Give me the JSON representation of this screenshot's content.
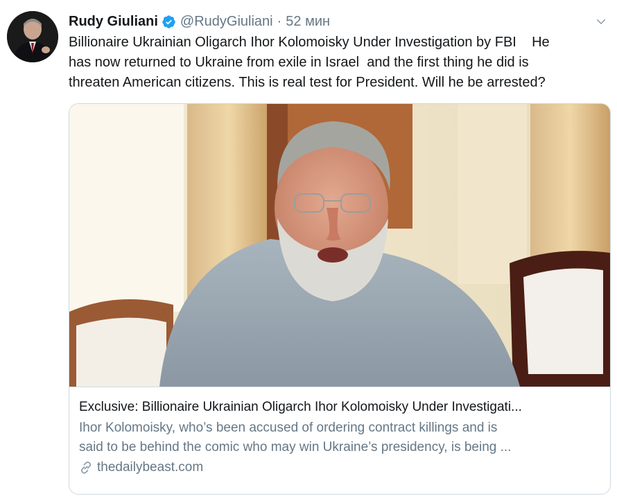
{
  "author": {
    "name": "Rudy Giuliani",
    "handle": "@RudyGiuliani",
    "separator": "·",
    "time": "52 мин",
    "verified": true
  },
  "tweet": {
    "lines": [
      "Billionaire Ukrainian Oligarch Ihor Kolomoisky Under Investigation by FBI    He",
      "has now returned to Ukraine from exile in Israel  and the first thing he did is",
      "threaten American citizens. This is real test for President. Will he be arrested?"
    ]
  },
  "card": {
    "title": "Exclusive: Billionaire Ukrainian Oligarch Ihor Kolomoisky Under Investigati...",
    "description_lines": [
      "Ihor Kolomoisky, who’s been accused of ordering contract killings and is",
      "said to be behind the comic who may win Ukraine’s presidency, is being ..."
    ],
    "domain": "thedailybeast.com"
  },
  "icons": {
    "verified": "verified-badge-icon",
    "caret": "chevron-down-icon",
    "link": "link-icon"
  },
  "colors": {
    "verified_blue": "#1da1f2",
    "secondary_text": "#657786",
    "primary_text": "#14171a",
    "border": "#cfd9de"
  }
}
